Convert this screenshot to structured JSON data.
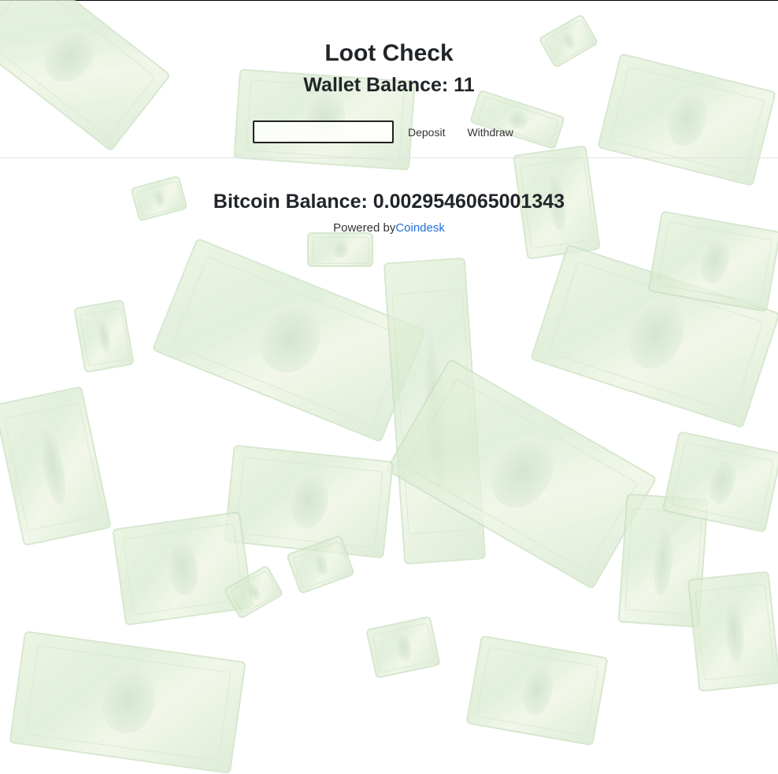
{
  "header": {
    "title": "Loot Check",
    "wallet_label": "Wallet Balance: 11"
  },
  "form": {
    "amount_value": "",
    "deposit_label": "Deposit",
    "withdraw_label": "Withdraw"
  },
  "bitcoin": {
    "balance_label": "Bitcoin Balance: 0.0029546065001343",
    "powered_prefix": "Powered by",
    "powered_link": "Coindesk"
  },
  "theme": {
    "link_color": "#1e6fd9",
    "text_color": "#212529"
  }
}
